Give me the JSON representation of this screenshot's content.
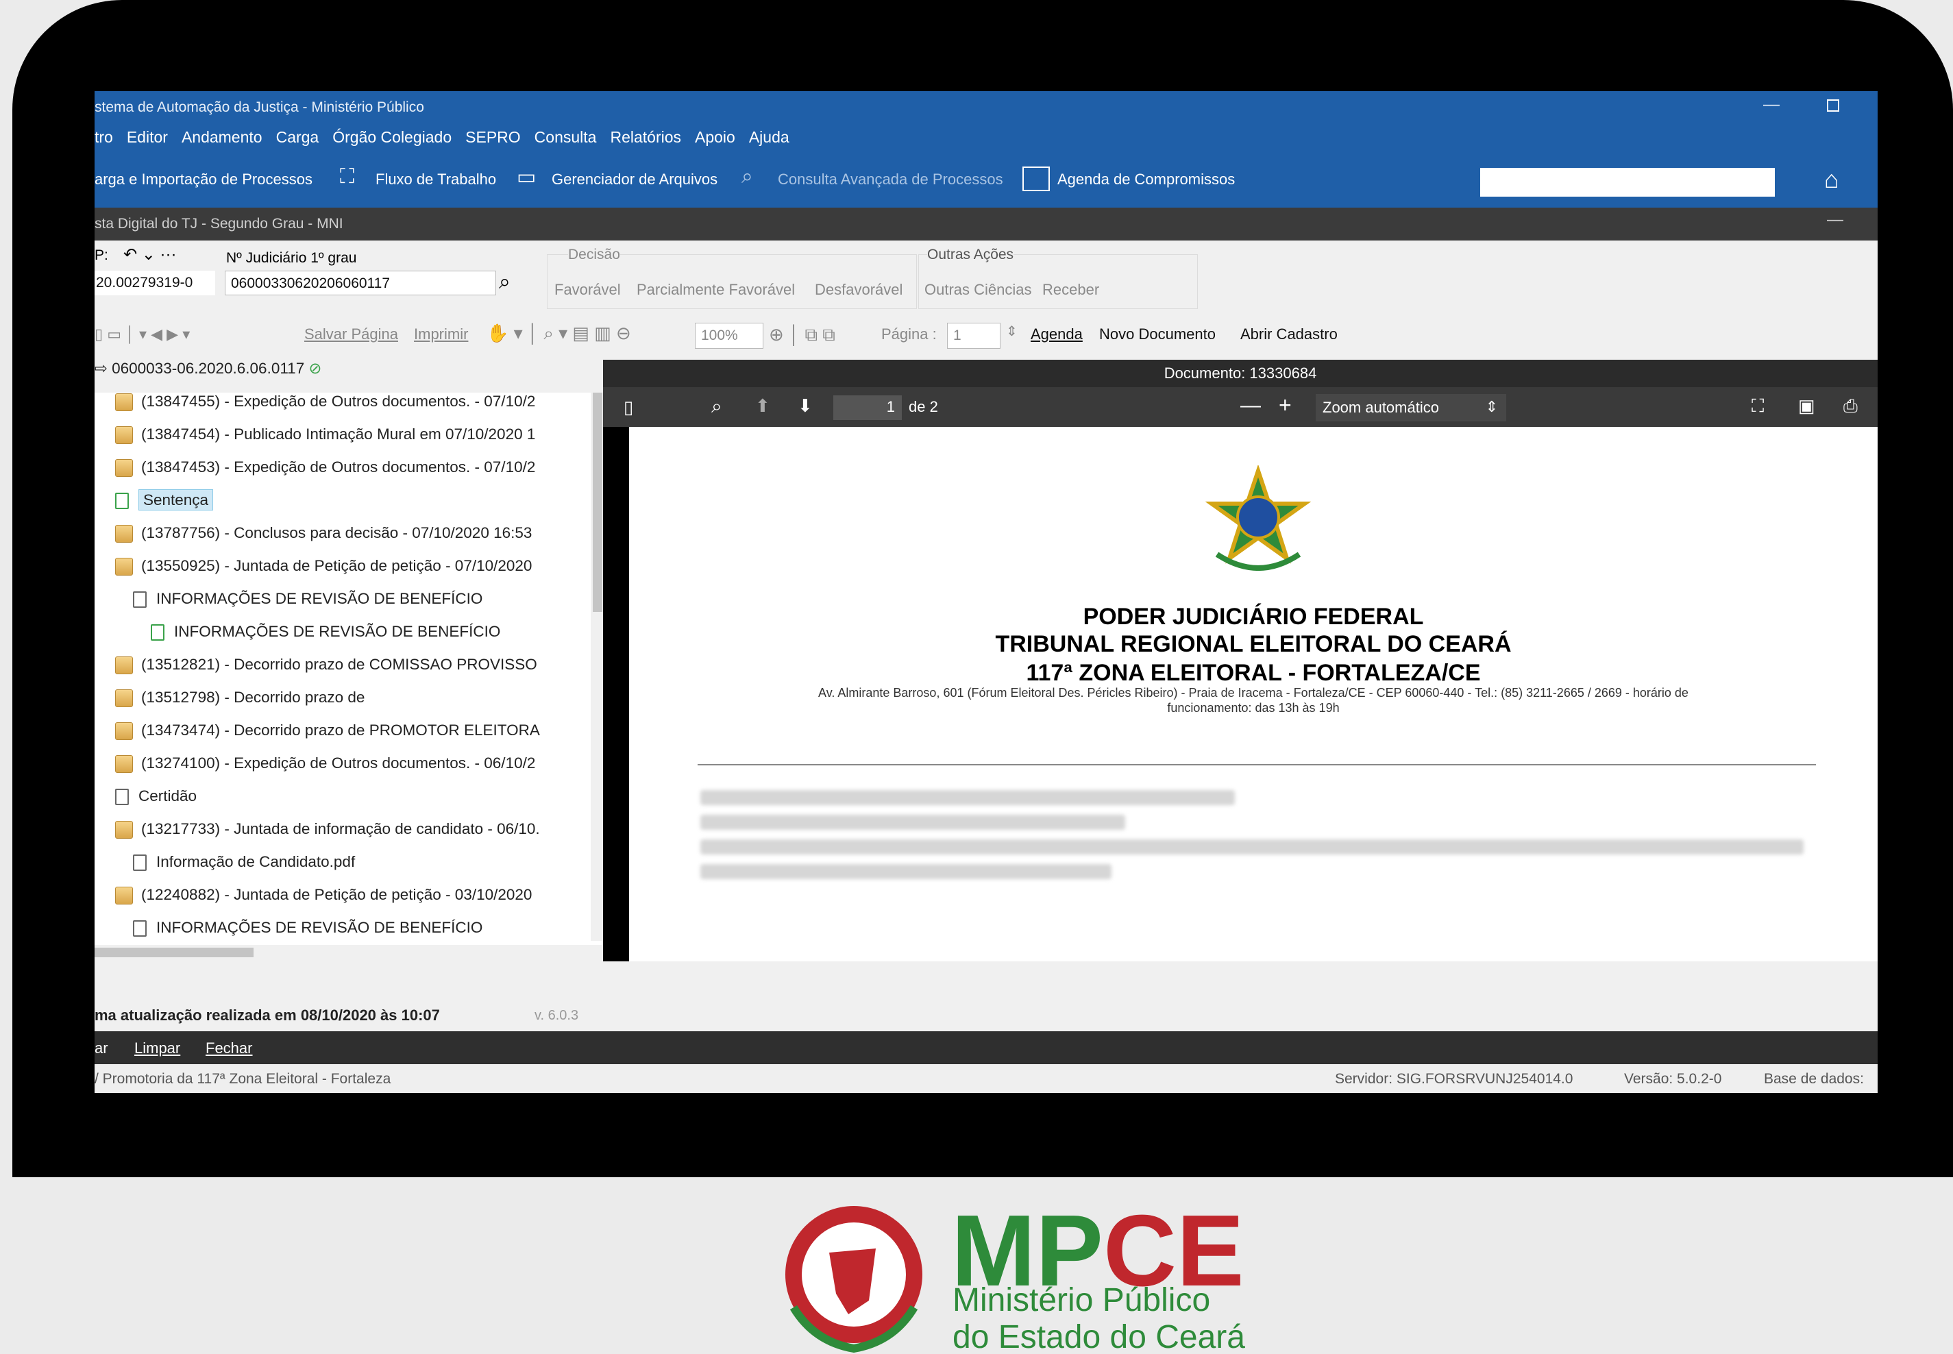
{
  "window": {
    "title": "stema de Automação da Justiça - Ministério Público"
  },
  "menu": [
    "tro",
    "Editor",
    "Andamento",
    "Carga",
    "Órgão Colegiado",
    "SEPRO",
    "Consulta",
    "Relatórios",
    "Apoio",
    "Ajuda"
  ],
  "toolbar": {
    "carga": "arga e Importação de Processos",
    "fluxo": "Fluxo de Trabalho",
    "gerenciador": "Gerenciador de Arquivos",
    "consulta": "Consulta Avançada de Processos",
    "agenda": "Agenda de Compromissos"
  },
  "subtitle": "sta Digital do TJ - Segundo  Grau - MNI",
  "form": {
    "p_label": "P:",
    "p_value": "20.00279319-0",
    "nj_label": "Nº Judiciário   1º grau",
    "nj_value": "06000330620206060117",
    "decisao_label": "Decisão",
    "decisao": [
      "Favorável",
      "Parcialmente Favorável",
      "Desfavorável"
    ],
    "outras_label": "Outras Ações",
    "outras": [
      "Outras Ciências",
      "Receber"
    ]
  },
  "doctoolbar": {
    "salvar": "Salvar Página",
    "imprimir": "Imprimir",
    "zoom": "100%",
    "pagina_label": "Página :",
    "pagina_value": "1",
    "agenda": "Agenda",
    "novo": "Novo Documento",
    "abrir": "Abrir Cadastro"
  },
  "tree": {
    "root": "0600033-06.2020.6.06.0117",
    "items": [
      "(13847455) - Expedição de Outros documentos. - 07/10/2",
      "(13847454) - Publicado Intimação Mural em 07/10/2020 1",
      "(13847453) - Expedição de Outros documentos. - 07/10/2",
      "Sentença",
      "(13787756) - Conclusos para decisão - 07/10/2020 16:53",
      "(13550925) - Juntada de Petição de petição - 07/10/2020",
      "INFORMAÇÕES DE REVISÃO DE BENEFÍCIO",
      "INFORMAÇÕES DE REVISÃO DE BENEFÍCIO",
      "(13512821) - Decorrido prazo de COMISSAO PROVISSO",
      "(13512798) - Decorrido prazo de",
      "(13473474) - Decorrido prazo de PROMOTOR ELEITORA",
      "(13274100) - Expedição de Outros documentos. - 06/10/2",
      "Certidão",
      "(13217733) - Juntada de informação de candidato - 06/10.",
      "Informação de Candidato.pdf",
      "(12240882) - Juntada de Petição de petição - 03/10/2020",
      "INFORMAÇÕES DE REVISÃO DE BENEFÍCIO"
    ]
  },
  "update": {
    "text": "ma atualização realizada em 08/10/2020 às 10:07",
    "version": "v. 6.0.3"
  },
  "pdf": {
    "doc_label": "Documento: 13330684",
    "page": "1",
    "of": "de 2",
    "zoom": "Zoom automático",
    "line1": "PODER JUDICIÁRIO FEDERAL",
    "line2": "TRIBUNAL REGIONAL ELEITORAL DO CEARÁ",
    "line3": "117ª ZONA ELEITORAL - FORTALEZA/CE",
    "address1": "Av. Almirante Barroso, 601 (Fórum Eleitoral Des. Péricles Ribeiro) - Praia de Iracema - Fortaleza/CE - CEP 60060-440 - Tel.: (85) 3211-2665 / 2669 - horário de",
    "address2": "funcionamento: das 13h às 19h"
  },
  "statusbar": {
    "b1": "ar",
    "b2": "Limpar",
    "b3": "Fechar"
  },
  "footer": {
    "left": "/ Promotoria da 117ª Zona Eleitoral - Fortaleza",
    "servidor": "Servidor: SIG.FORSRVUNJ254014.0",
    "versao": "Versão: 5.0.2-0",
    "base": "Base de dados:"
  },
  "logo": {
    "name": "MPCE",
    "line1": "Ministério Público",
    "line2": "do Estado do Ceará"
  },
  "colors": {
    "accent": "#1f5fa8",
    "brand_red": "#c0272d",
    "brand_green": "#2e8b3a"
  }
}
